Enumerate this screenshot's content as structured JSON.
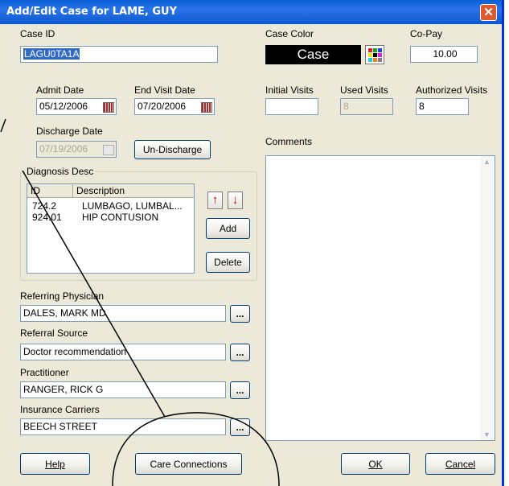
{
  "window": {
    "title": "Add/Edit Case for LAME, GUY",
    "close_symbol": "✕"
  },
  "case_id": {
    "label": "Case ID",
    "value": "LAGU0TA1A"
  },
  "case_color": {
    "label": "Case Color",
    "swatch_text": "Case",
    "swatch_bg": "#000000"
  },
  "copay": {
    "label": "Co-Pay",
    "value": "10.00"
  },
  "admit_date": {
    "label": "Admit Date",
    "value": "05/12/2006"
  },
  "end_visit_date": {
    "label": "End Visit Date",
    "value": "07/20/2006"
  },
  "discharge_date": {
    "label": "Discharge Date",
    "value": "07/19/2006"
  },
  "undischarge_button": "Un-Discharge",
  "visits": {
    "initial_label": "Initial Visits",
    "initial_value": "",
    "used_label": "Used Visits",
    "used_value": "8",
    "authorized_label": "Authorized Visits",
    "authorized_value": "8"
  },
  "comments": {
    "label": "Comments",
    "value": ""
  },
  "diagnosis": {
    "group_label": "Diagnosis Desc",
    "columns": [
      "ID",
      "Description"
    ],
    "rows": [
      {
        "id": "724.2",
        "desc": "LUMBAGO, LUMBAL..."
      },
      {
        "id": "924.01",
        "desc": "HIP CONTUSION"
      }
    ],
    "add_button": "Add",
    "delete_button": "Delete",
    "up_symbol": "↑",
    "down_symbol": "↓"
  },
  "referring_physician": {
    "label": "Referring Physician",
    "value": "DALES, MARK  MD"
  },
  "referral_source": {
    "label": "Referral Source",
    "value": "Doctor recommendation"
  },
  "practitioner": {
    "label": "Practitioner",
    "value": "RANGER, RICK G"
  },
  "insurance_carriers": {
    "label": "Insurance Carriers",
    "value": "BEECH STREET"
  },
  "ellipsis": "...",
  "buttons": {
    "help": "Help",
    "care_connections": "Care Connections",
    "ok": "OK",
    "cancel": "Cancel"
  }
}
